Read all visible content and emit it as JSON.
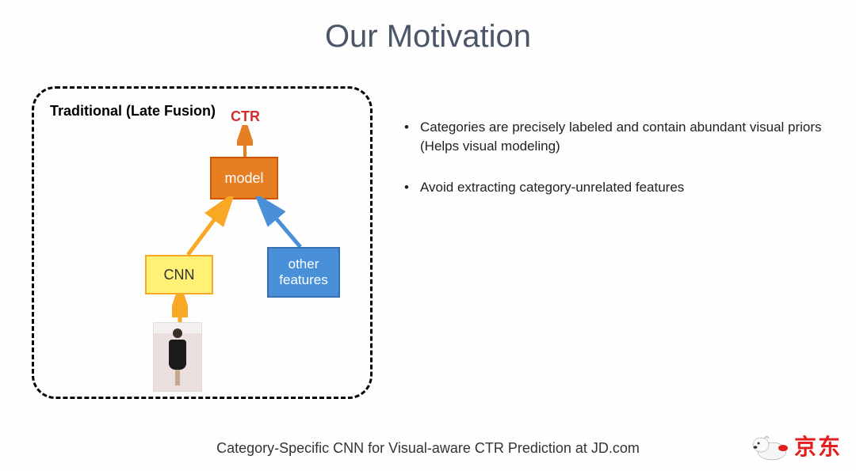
{
  "title": "Our Motivation",
  "diagram": {
    "label": "Traditional (Late Fusion)",
    "ctr": "CTR",
    "model": "model",
    "cnn": "CNN",
    "other_line1": "other",
    "other_line2": "features"
  },
  "bullets": {
    "b1": "Categories are precisely labeled and contain abundant visual priors (Helps visual modeling)",
    "b2": "Avoid extracting category-unrelated features"
  },
  "footer": "Category-Specific CNN for Visual-aware CTR Prediction at JD.com",
  "logo": {
    "text": "京东"
  }
}
